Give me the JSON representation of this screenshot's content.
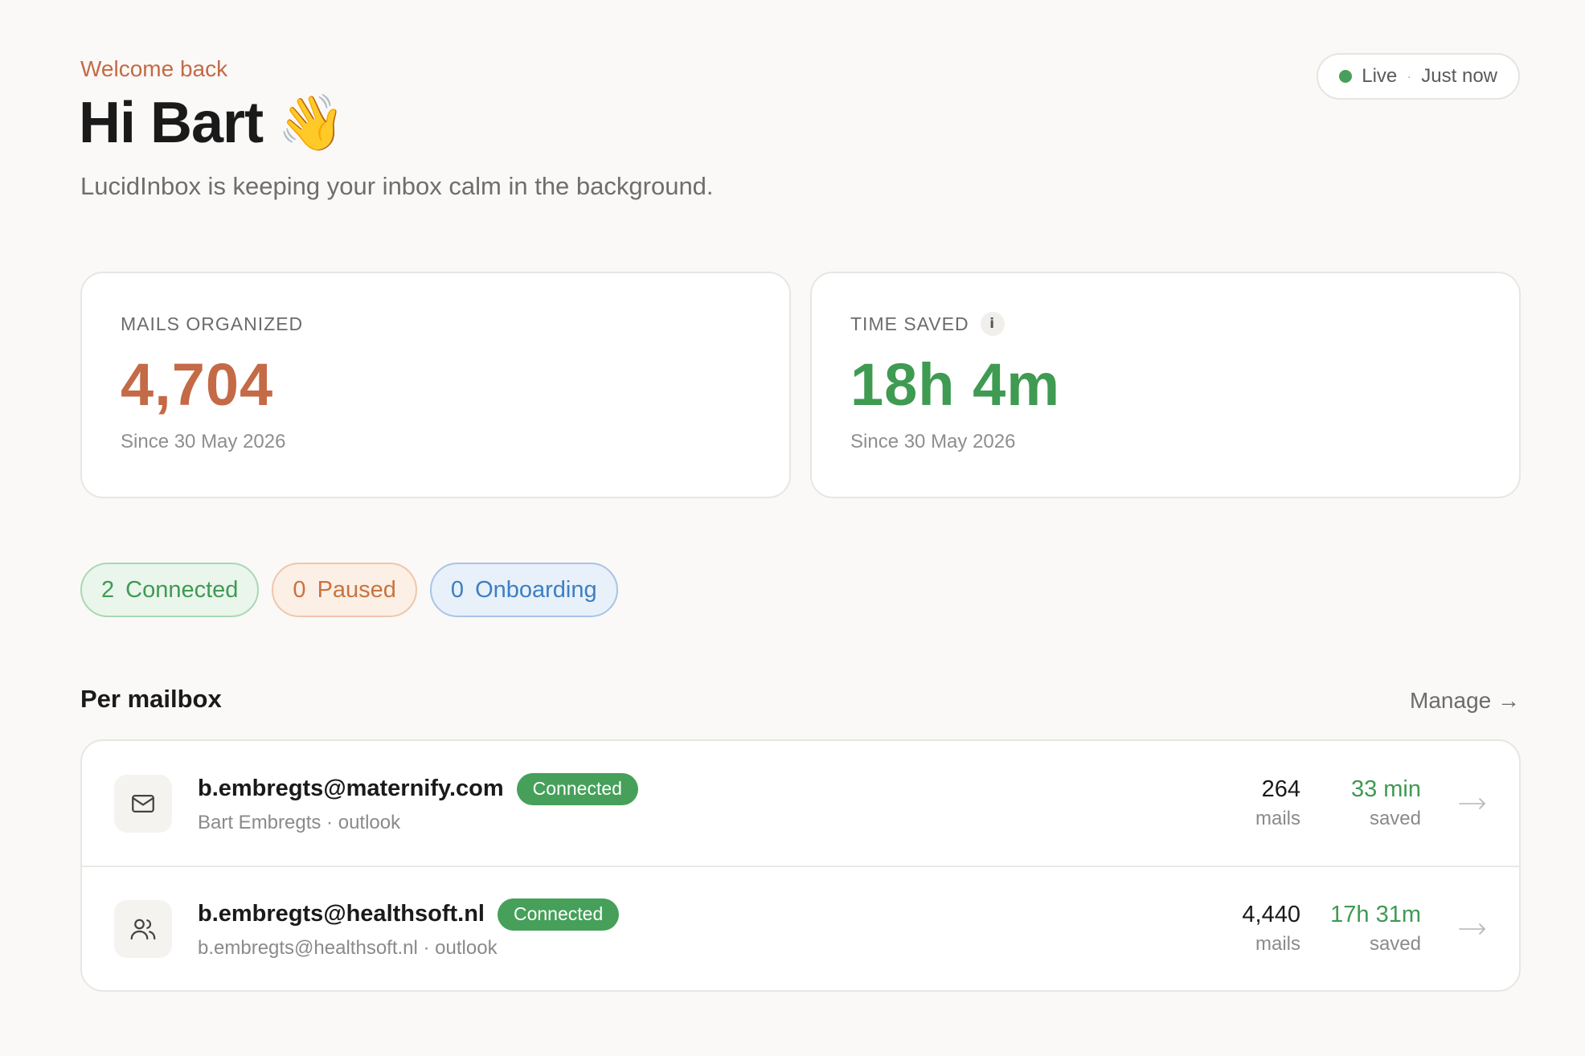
{
  "header": {
    "welcome": "Welcome back",
    "greeting": "Hi Bart",
    "greeting_emoji": "👋",
    "subtitle": "LucidInbox is keeping your inbox calm in the background."
  },
  "live_status": {
    "label": "Live",
    "separator": "·",
    "updated": "Just now"
  },
  "stats": {
    "mails": {
      "label": "MAILS ORGANIZED",
      "value": "4,704",
      "since": "Since 30 May 2026"
    },
    "time": {
      "label": "TIME SAVED",
      "info_icon": "i",
      "value": "18h 4m",
      "since": "Since 30 May 2026"
    }
  },
  "chips": {
    "connected": {
      "count": "2",
      "label": "Connected"
    },
    "paused": {
      "count": "0",
      "label": "Paused"
    },
    "onboarding": {
      "count": "0",
      "label": "Onboarding"
    }
  },
  "mailboxes": {
    "title": "Per mailbox",
    "manage_label": "Manage →",
    "items": [
      {
        "email": "b.embregts@maternify.com",
        "status": "Connected",
        "sub": "Bart Embregts · outlook",
        "mails": "264",
        "mails_unit": "mails",
        "saved": "33 min",
        "saved_unit": "saved",
        "icon": "mail-icon"
      },
      {
        "email": "b.embregts@healthsoft.nl",
        "status": "Connected",
        "sub": "b.embregts@healthsoft.nl · outlook",
        "mails": "4,440",
        "mails_unit": "mails",
        "saved": "17h 31m",
        "saved_unit": "saved",
        "icon": "users-icon"
      }
    ]
  },
  "colors": {
    "accent_orange": "#c46a47",
    "accent_green": "#3f9a52",
    "status_blue": "#3c7fc2",
    "background": "#faf9f7"
  }
}
